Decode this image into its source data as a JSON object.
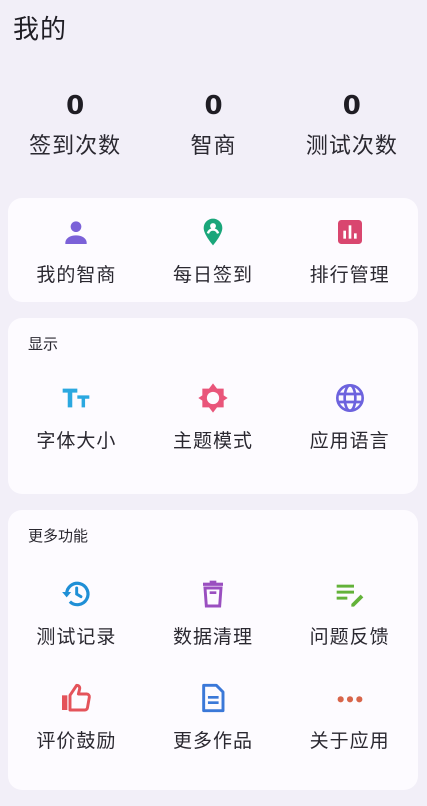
{
  "header": {
    "title": "我的"
  },
  "stats": [
    {
      "value": "0",
      "label": "签到次数"
    },
    {
      "value": "0",
      "label": "智商"
    },
    {
      "value": "0",
      "label": "测试次数"
    }
  ],
  "quick": {
    "items": [
      {
        "label": "我的智商",
        "icon": "person-icon",
        "color": "#7b61d8"
      },
      {
        "label": "每日签到",
        "icon": "location-pin-icon",
        "color": "#1aa67a"
      },
      {
        "label": "排行管理",
        "icon": "bar-chart-icon",
        "color": "#d9466f"
      }
    ]
  },
  "display": {
    "title": "显示",
    "items": [
      {
        "label": "字体大小",
        "icon": "text-size-icon",
        "color": "#2ba8e0"
      },
      {
        "label": "主题模式",
        "icon": "brightness-icon",
        "color": "#e9557a"
      },
      {
        "label": "应用语言",
        "icon": "globe-icon",
        "color": "#6d63de"
      }
    ]
  },
  "more": {
    "title": "更多功能",
    "items": [
      {
        "label": "测试记录",
        "icon": "history-icon",
        "color": "#1f8fd6"
      },
      {
        "label": "数据清理",
        "icon": "trash-icon",
        "color": "#9a4fc0"
      },
      {
        "label": "问题反馈",
        "icon": "edit-note-icon",
        "color": "#63b23a"
      },
      {
        "label": "评价鼓励",
        "icon": "thumb-up-icon",
        "color": "#e4535a"
      },
      {
        "label": "更多作品",
        "icon": "document-icon",
        "color": "#3a78d8"
      },
      {
        "label": "关于应用",
        "icon": "more-dots-icon",
        "color": "#d8654a"
      }
    ]
  }
}
